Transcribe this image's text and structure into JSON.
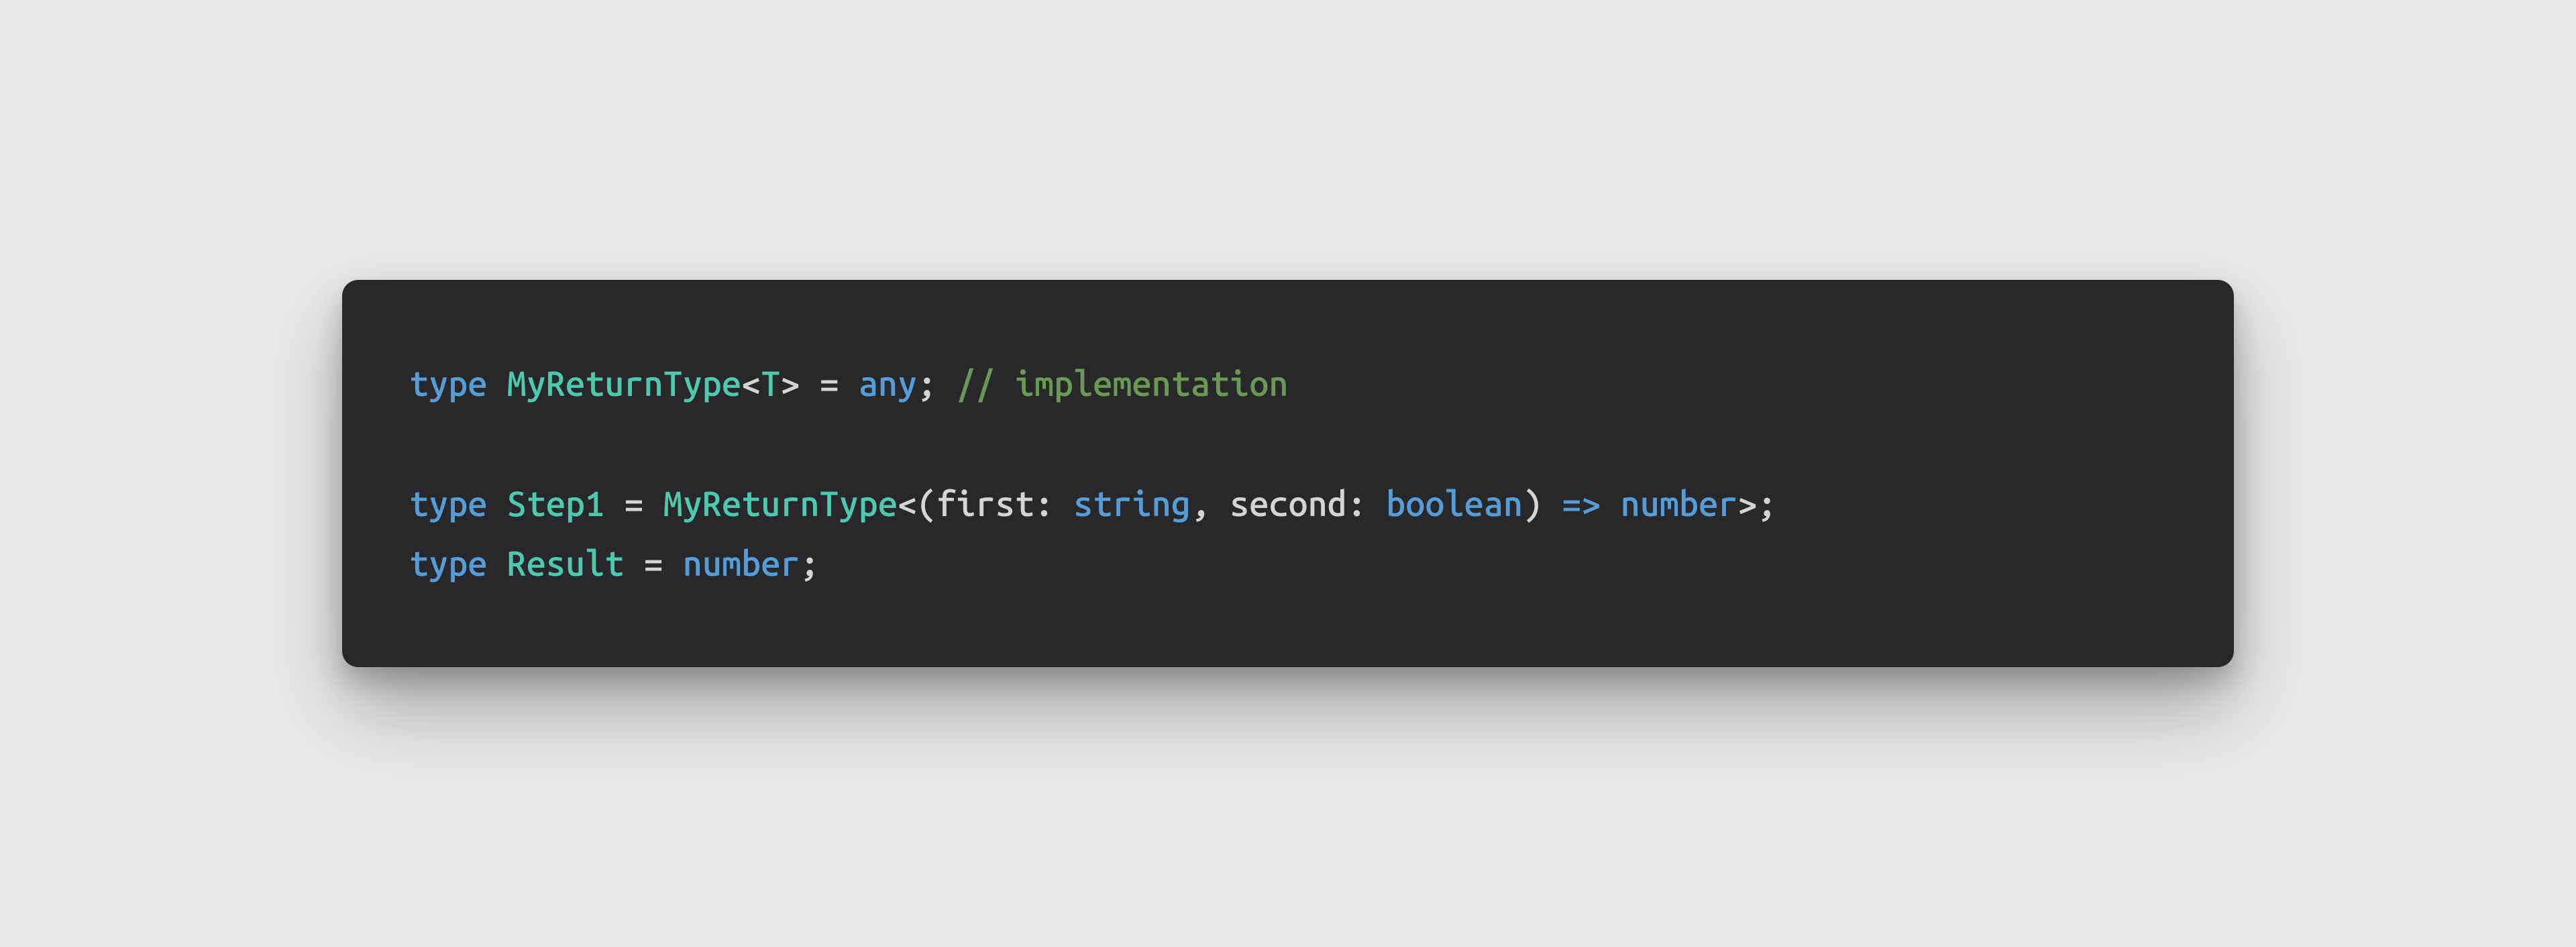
{
  "code": {
    "line1": {
      "kw_type": "type",
      "sp1": " ",
      "name": "MyReturnType",
      "lt": "<",
      "generic": "T",
      "gt": ">",
      "sp2": " ",
      "eq": "=",
      "sp3": " ",
      "any": "any",
      "semi": ";",
      "sp4": " ",
      "comment": "// implementation"
    },
    "blank": "",
    "line3": {
      "kw_type": "type",
      "sp1": " ",
      "name": "Step1",
      "sp2": " ",
      "eq": "=",
      "sp3": " ",
      "callee": "MyReturnType",
      "lt": "<",
      "lparen": "(",
      "p1_name": "first",
      "p1_colon": ":",
      "p1_sp": " ",
      "p1_type": "string",
      "comma": ",",
      "sp4": " ",
      "p2_name": "second",
      "p2_colon": ":",
      "p2_sp": " ",
      "p2_type": "boolean",
      "rparen": ")",
      "sp5": " ",
      "arrow": "=>",
      "sp6": " ",
      "ret": "number",
      "gt": ">",
      "semi": ";"
    },
    "line4": {
      "kw_type": "type",
      "sp1": " ",
      "name": "Result",
      "sp2": " ",
      "eq": "=",
      "sp3": " ",
      "val": "number",
      "semi": ";"
    }
  }
}
